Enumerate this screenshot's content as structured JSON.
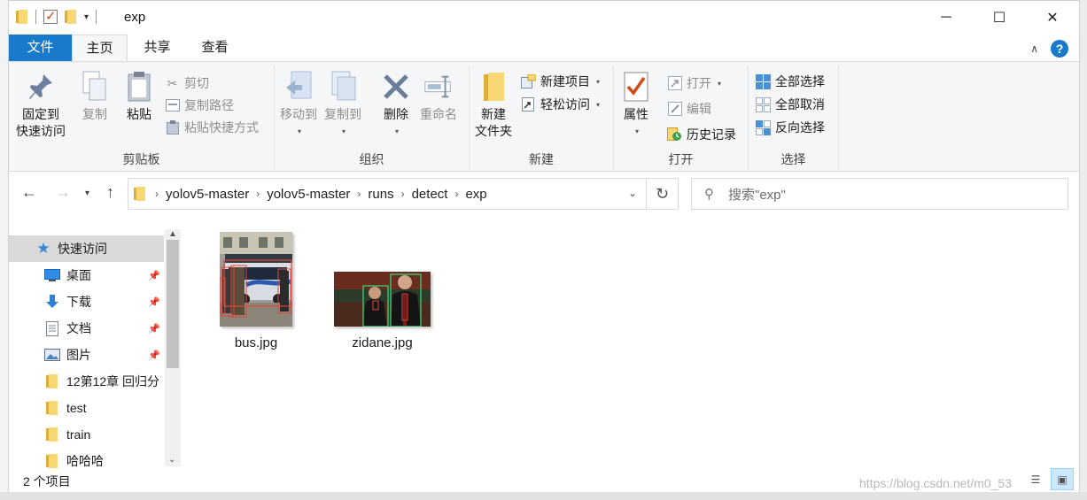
{
  "window": {
    "title": "exp"
  },
  "tabs": [
    "文件",
    "主页",
    "共享",
    "查看"
  ],
  "ribbon": {
    "clipboard": {
      "label": "剪贴板",
      "pin": "固定到\n快速访问",
      "copy": "复制",
      "paste": "粘贴",
      "cut": "剪切",
      "copy_path": "复制路径",
      "paste_shortcut": "粘贴快捷方式"
    },
    "organize": {
      "label": "组织",
      "move_to": "移动到",
      "copy_to": "复制到",
      "delete": "删除",
      "rename": "重命名"
    },
    "new": {
      "label": "新建",
      "new_folder": "新建\n文件夹",
      "new_item": "新建项目",
      "easy_access": "轻松访问"
    },
    "open": {
      "label": "打开",
      "properties": "属性",
      "open": "打开",
      "edit": "编辑",
      "history": "历史记录"
    },
    "select": {
      "label": "选择",
      "select_all": "全部选择",
      "select_none": "全部取消",
      "invert": "反向选择"
    }
  },
  "address": {
    "crumbs": [
      "yolov5-master",
      "yolov5-master",
      "runs",
      "detect",
      "exp"
    ],
    "search_placeholder": "搜索\"exp\""
  },
  "navpane": {
    "items": [
      {
        "label": "快速访问",
        "icon": "star-icon",
        "pinned": false
      },
      {
        "label": "桌面",
        "icon": "desktop-icon",
        "pinned": true
      },
      {
        "label": "下载",
        "icon": "download-icon",
        "pinned": true
      },
      {
        "label": "文档",
        "icon": "document-icon",
        "pinned": true
      },
      {
        "label": "图片",
        "icon": "pictures-icon",
        "pinned": true
      },
      {
        "label": "12第12章  回归分",
        "icon": "folder-icon",
        "pinned": false
      },
      {
        "label": "test",
        "icon": "folder-icon",
        "pinned": false
      },
      {
        "label": "train",
        "icon": "folder-icon",
        "pinned": false
      },
      {
        "label": "哈哈哈",
        "icon": "folder-icon",
        "pinned": false
      }
    ]
  },
  "files": [
    {
      "name": "bus.jpg"
    },
    {
      "name": "zidane.jpg"
    }
  ],
  "status": {
    "count": "2 个项目"
  },
  "watermark": "https://blog.csdn.net/m0_53"
}
